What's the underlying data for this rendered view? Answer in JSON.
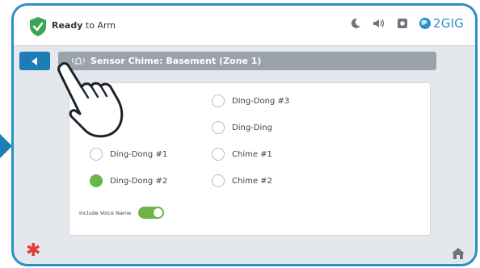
{
  "status": {
    "text_bold": "Ready",
    "text_rest": " to Arm"
  },
  "brand": {
    "name": "2GIG"
  },
  "title": {
    "text": "Sensor Chime: Basement (Zone 1)"
  },
  "options": [
    {
      "label": "Ding-Dong #3",
      "selected": false
    },
    {
      "label": "Ding-Ding",
      "selected": false
    },
    {
      "label": "Ding-Dong #1",
      "selected": false
    },
    {
      "label": "Chime #1",
      "selected": false
    },
    {
      "label": "Ding-Dong #2",
      "selected": true
    },
    {
      "label": "Chime #2",
      "selected": false
    }
  ],
  "voice": {
    "label": "Include Voice Name",
    "enabled": true
  },
  "colors": {
    "accent": "#1b7db3",
    "selected": "#6ab547",
    "panic": "#e53935",
    "frame": "#2a8fc6"
  }
}
